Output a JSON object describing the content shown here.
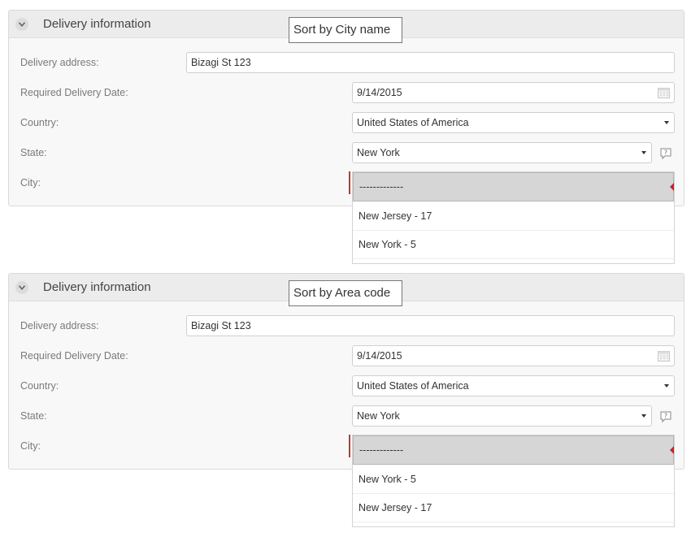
{
  "panels": [
    {
      "title": "Delivery information",
      "tooltip": "Sort by City name",
      "labels": {
        "address": "Delivery address:",
        "date": "Required Delivery Date:",
        "country": "Country:",
        "state": "State:",
        "city": "City:"
      },
      "values": {
        "address": "Bizagi St 123",
        "date": "9/14/2015",
        "country": "United States of America",
        "state": "New York"
      },
      "city_dropdown": {
        "selected": "-------------",
        "options": [
          "New Jersey - 17",
          "New York - 5"
        ]
      }
    },
    {
      "title": "Delivery information",
      "tooltip": "Sort by Area code",
      "labels": {
        "address": "Delivery address:",
        "date": "Required Delivery Date:",
        "country": "Country:",
        "state": "State:",
        "city": "City:"
      },
      "values": {
        "address": "Bizagi St 123",
        "date": "9/14/2015",
        "country": "United States of America",
        "state": "New York"
      },
      "city_dropdown": {
        "selected": "-------------",
        "options": [
          "New York - 5",
          "New Jersey - 17"
        ]
      }
    }
  ],
  "icons": {
    "collapse": "chevron-down-icon",
    "calendar": "calendar-icon",
    "help": "help-icon"
  },
  "colors": {
    "panel_header": "#ececec",
    "panel_body": "#f8f8f8",
    "dropdown_selected": "#d6d6d6",
    "required": "#d21f1f"
  }
}
